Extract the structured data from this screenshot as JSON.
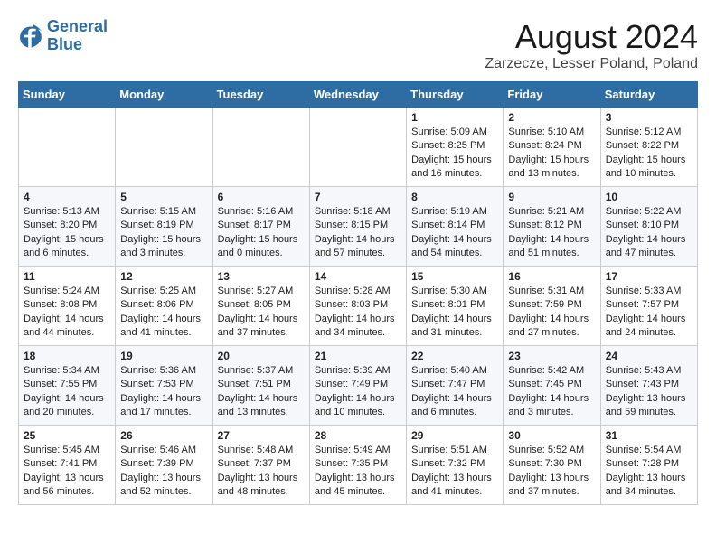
{
  "header": {
    "logo_line1": "General",
    "logo_line2": "Blue",
    "month_year": "August 2024",
    "location": "Zarzecze, Lesser Poland, Poland"
  },
  "weekdays": [
    "Sunday",
    "Monday",
    "Tuesday",
    "Wednesday",
    "Thursday",
    "Friday",
    "Saturday"
  ],
  "weeks": [
    [
      {
        "day": "",
        "content": ""
      },
      {
        "day": "",
        "content": ""
      },
      {
        "day": "",
        "content": ""
      },
      {
        "day": "",
        "content": ""
      },
      {
        "day": "1",
        "content": "Sunrise: 5:09 AM\nSunset: 8:25 PM\nDaylight: 15 hours\nand 16 minutes."
      },
      {
        "day": "2",
        "content": "Sunrise: 5:10 AM\nSunset: 8:24 PM\nDaylight: 15 hours\nand 13 minutes."
      },
      {
        "day": "3",
        "content": "Sunrise: 5:12 AM\nSunset: 8:22 PM\nDaylight: 15 hours\nand 10 minutes."
      }
    ],
    [
      {
        "day": "4",
        "content": "Sunrise: 5:13 AM\nSunset: 8:20 PM\nDaylight: 15 hours\nand 6 minutes."
      },
      {
        "day": "5",
        "content": "Sunrise: 5:15 AM\nSunset: 8:19 PM\nDaylight: 15 hours\nand 3 minutes."
      },
      {
        "day": "6",
        "content": "Sunrise: 5:16 AM\nSunset: 8:17 PM\nDaylight: 15 hours\nand 0 minutes."
      },
      {
        "day": "7",
        "content": "Sunrise: 5:18 AM\nSunset: 8:15 PM\nDaylight: 14 hours\nand 57 minutes."
      },
      {
        "day": "8",
        "content": "Sunrise: 5:19 AM\nSunset: 8:14 PM\nDaylight: 14 hours\nand 54 minutes."
      },
      {
        "day": "9",
        "content": "Sunrise: 5:21 AM\nSunset: 8:12 PM\nDaylight: 14 hours\nand 51 minutes."
      },
      {
        "day": "10",
        "content": "Sunrise: 5:22 AM\nSunset: 8:10 PM\nDaylight: 14 hours\nand 47 minutes."
      }
    ],
    [
      {
        "day": "11",
        "content": "Sunrise: 5:24 AM\nSunset: 8:08 PM\nDaylight: 14 hours\nand 44 minutes."
      },
      {
        "day": "12",
        "content": "Sunrise: 5:25 AM\nSunset: 8:06 PM\nDaylight: 14 hours\nand 41 minutes."
      },
      {
        "day": "13",
        "content": "Sunrise: 5:27 AM\nSunset: 8:05 PM\nDaylight: 14 hours\nand 37 minutes."
      },
      {
        "day": "14",
        "content": "Sunrise: 5:28 AM\nSunset: 8:03 PM\nDaylight: 14 hours\nand 34 minutes."
      },
      {
        "day": "15",
        "content": "Sunrise: 5:30 AM\nSunset: 8:01 PM\nDaylight: 14 hours\nand 31 minutes."
      },
      {
        "day": "16",
        "content": "Sunrise: 5:31 AM\nSunset: 7:59 PM\nDaylight: 14 hours\nand 27 minutes."
      },
      {
        "day": "17",
        "content": "Sunrise: 5:33 AM\nSunset: 7:57 PM\nDaylight: 14 hours\nand 24 minutes."
      }
    ],
    [
      {
        "day": "18",
        "content": "Sunrise: 5:34 AM\nSunset: 7:55 PM\nDaylight: 14 hours\nand 20 minutes."
      },
      {
        "day": "19",
        "content": "Sunrise: 5:36 AM\nSunset: 7:53 PM\nDaylight: 14 hours\nand 17 minutes."
      },
      {
        "day": "20",
        "content": "Sunrise: 5:37 AM\nSunset: 7:51 PM\nDaylight: 14 hours\nand 13 minutes."
      },
      {
        "day": "21",
        "content": "Sunrise: 5:39 AM\nSunset: 7:49 PM\nDaylight: 14 hours\nand 10 minutes."
      },
      {
        "day": "22",
        "content": "Sunrise: 5:40 AM\nSunset: 7:47 PM\nDaylight: 14 hours\nand 6 minutes."
      },
      {
        "day": "23",
        "content": "Sunrise: 5:42 AM\nSunset: 7:45 PM\nDaylight: 14 hours\nand 3 minutes."
      },
      {
        "day": "24",
        "content": "Sunrise: 5:43 AM\nSunset: 7:43 PM\nDaylight: 13 hours\nand 59 minutes."
      }
    ],
    [
      {
        "day": "25",
        "content": "Sunrise: 5:45 AM\nSunset: 7:41 PM\nDaylight: 13 hours\nand 56 minutes."
      },
      {
        "day": "26",
        "content": "Sunrise: 5:46 AM\nSunset: 7:39 PM\nDaylight: 13 hours\nand 52 minutes."
      },
      {
        "day": "27",
        "content": "Sunrise: 5:48 AM\nSunset: 7:37 PM\nDaylight: 13 hours\nand 48 minutes."
      },
      {
        "day": "28",
        "content": "Sunrise: 5:49 AM\nSunset: 7:35 PM\nDaylight: 13 hours\nand 45 minutes."
      },
      {
        "day": "29",
        "content": "Sunrise: 5:51 AM\nSunset: 7:32 PM\nDaylight: 13 hours\nand 41 minutes."
      },
      {
        "day": "30",
        "content": "Sunrise: 5:52 AM\nSunset: 7:30 PM\nDaylight: 13 hours\nand 37 minutes."
      },
      {
        "day": "31",
        "content": "Sunrise: 5:54 AM\nSunset: 7:28 PM\nDaylight: 13 hours\nand 34 minutes."
      }
    ]
  ]
}
